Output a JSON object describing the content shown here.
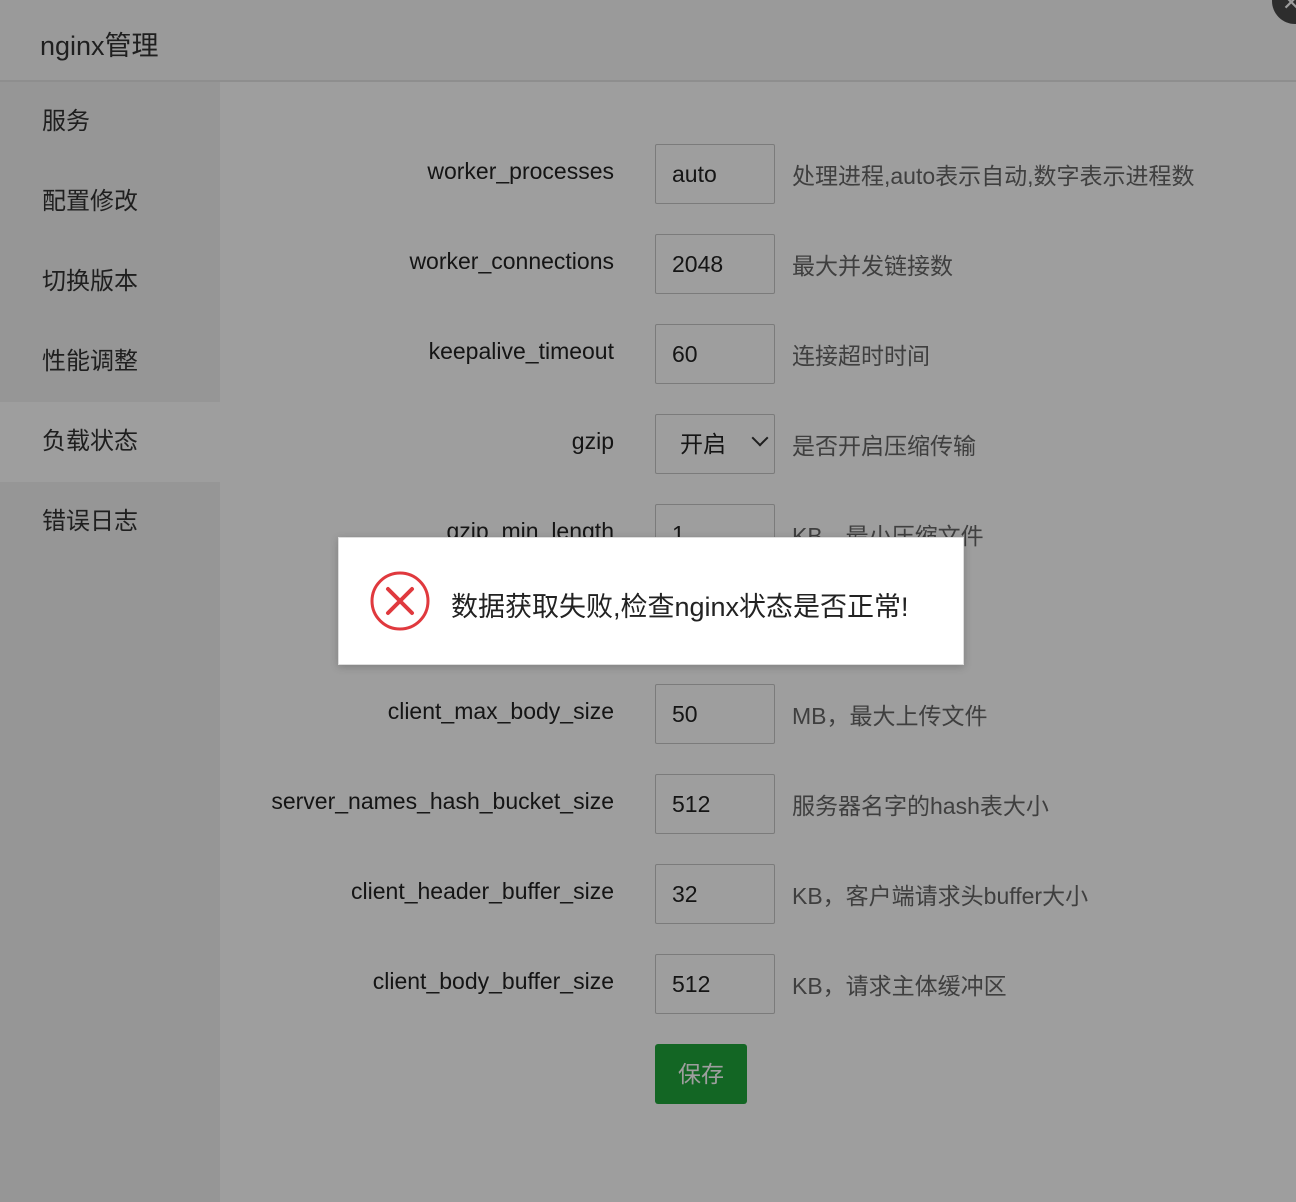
{
  "window": {
    "title": "nginx管理",
    "close_icon": "close-icon"
  },
  "sidebar": {
    "items": [
      {
        "label": "服务",
        "active": false
      },
      {
        "label": "配置修改",
        "active": false
      },
      {
        "label": "切换版本",
        "active": false
      },
      {
        "label": "性能调整",
        "active": false
      },
      {
        "label": "负载状态",
        "active": true
      },
      {
        "label": "错误日志",
        "active": false
      }
    ]
  },
  "form": {
    "rows": [
      {
        "label": "worker_processes",
        "value": "auto",
        "desc": "处理进程,auto表示自动,数字表示进程数"
      },
      {
        "label": "worker_connections",
        "value": "2048",
        "desc": "最大并发链接数"
      },
      {
        "label": "keepalive_timeout",
        "value": "60",
        "desc": "连接超时时间"
      },
      {
        "label": "gzip",
        "value": "开启",
        "desc": "是否开启压缩传输"
      },
      {
        "label": "gzip_min_length",
        "value": "1",
        "desc": "KB，最小压缩文件"
      },
      {
        "label": "client_max_body_size",
        "value": "50",
        "desc": "MB，最大上传文件"
      },
      {
        "label": "server_names_hash_bucket_size",
        "value": "512",
        "desc": "服务器名字的hash表大小"
      },
      {
        "label": "client_header_buffer_size",
        "value": "32",
        "desc": "KB，客户端请求头buffer大小"
      },
      {
        "label": "client_body_buffer_size",
        "value": "512",
        "desc": "KB，请求主体缓冲区"
      }
    ],
    "save_label": "保存",
    "save_color": "#20a53a"
  },
  "dialog": {
    "message": "数据获取失败,检查nginx状态是否正常!",
    "icon": "error-icon",
    "icon_color": "#e0393e"
  }
}
